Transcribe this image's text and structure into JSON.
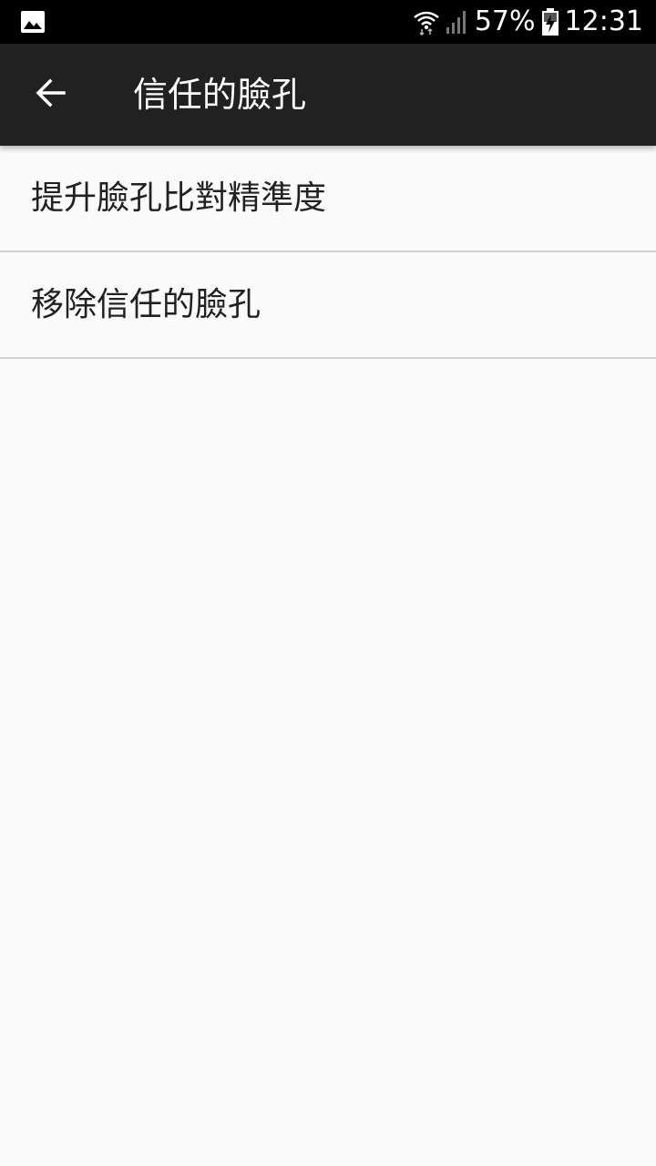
{
  "status_bar": {
    "notification_icon": "image-icon",
    "wifi_icon": "wifi-icon",
    "signal_icon": "cellular-signal-icon",
    "battery_percent": "57%",
    "battery_icon": "battery-charging-icon",
    "time": "12:31"
  },
  "app_bar": {
    "back_icon": "arrow-back-icon",
    "title": "信任的臉孔"
  },
  "menu": {
    "items": [
      {
        "label": "提升臉孔比對精準度"
      },
      {
        "label": "移除信任的臉孔"
      }
    ]
  },
  "colors": {
    "status_bar_bg": "#000000",
    "app_bar_bg": "#212121",
    "page_bg": "#fafafa",
    "text_primary": "#212121",
    "divider": "#d2d2d2"
  }
}
